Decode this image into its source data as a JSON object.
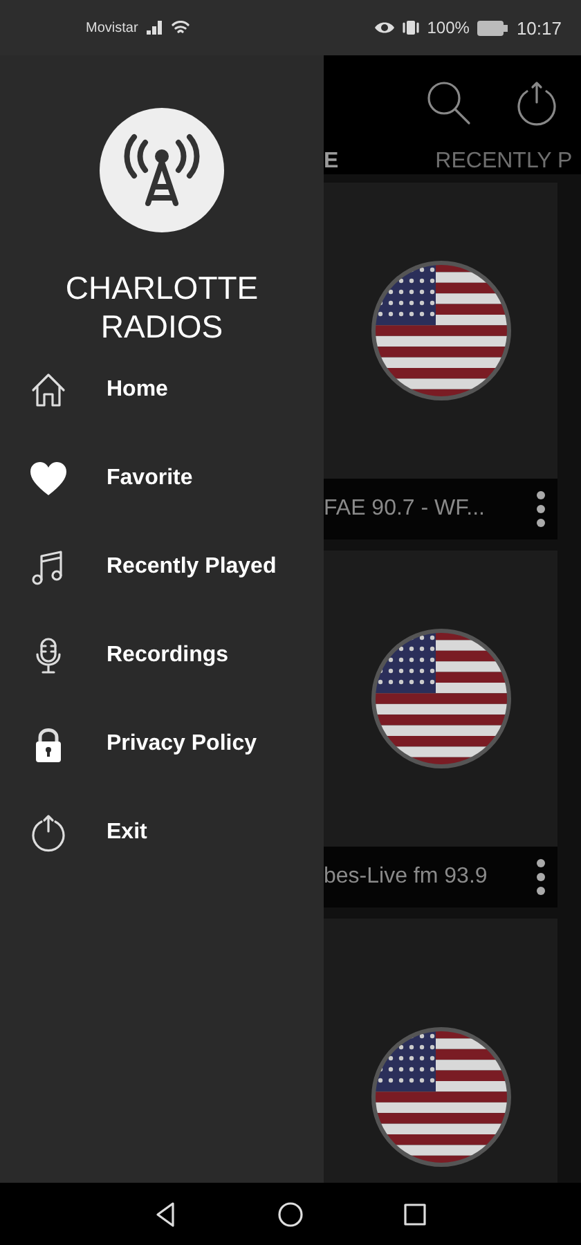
{
  "status_bar": {
    "carrier": "Movistar",
    "battery": "100%",
    "time": "10:17"
  },
  "drawer": {
    "title": "CHARLOTTE RADIOS",
    "items": [
      {
        "kind": "home",
        "label": "Home"
      },
      {
        "kind": "heart",
        "label": "Favorite"
      },
      {
        "kind": "music",
        "label": "Recently Played"
      },
      {
        "kind": "mic",
        "label": "Recordings"
      },
      {
        "kind": "lock",
        "label": "Privacy Policy"
      },
      {
        "kind": "power",
        "label": "Exit"
      }
    ]
  },
  "tabs": [
    {
      "label": "E",
      "selected": true
    },
    {
      "label": "RECENTLY P",
      "selected": false
    }
  ],
  "stations": [
    {
      "kind": "titled",
      "name": "FAE 90.7 - WF..."
    },
    {
      "kind": "titled",
      "name": "bes-Live fm 93.9"
    },
    {
      "kind": "cut"
    }
  ]
}
